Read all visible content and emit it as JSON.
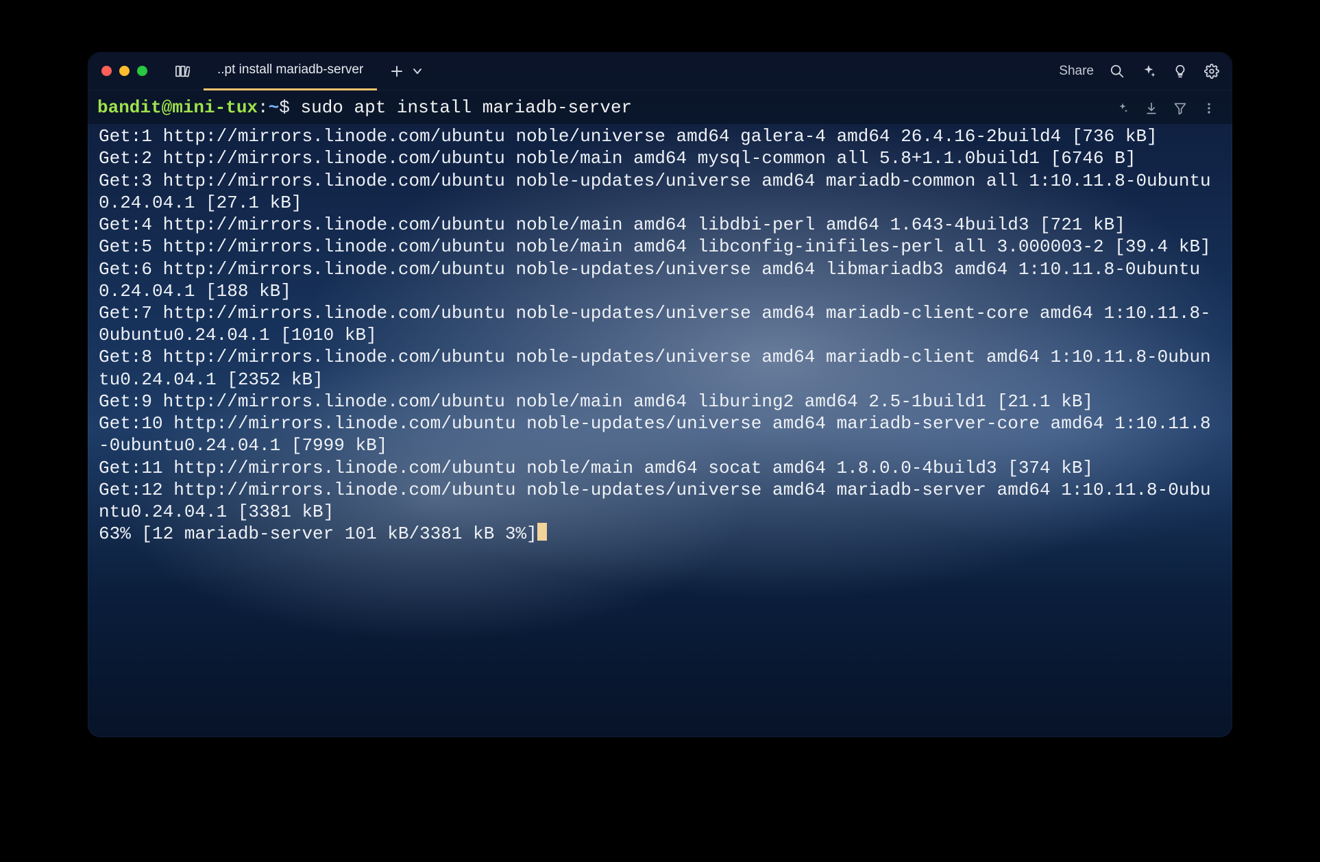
{
  "window": {
    "traffic_lights": {
      "close": "close",
      "minimize": "minimize",
      "zoom": "zoom"
    },
    "library_icon": "library-icon",
    "tab_title": "..pt install mariadb-server",
    "new_tab_icon": "plus-icon",
    "dropdown_icon": "chevron-down-icon",
    "share_label": "Share",
    "search_icon": "search-icon",
    "sparkle_icon": "sparkle-icon",
    "bulb_icon": "lightbulb-icon",
    "settings_icon": "gear-icon"
  },
  "prompt": {
    "user_host": "bandit@mini-tux",
    "colon": ":",
    "path": "~",
    "dollar": "$ ",
    "command": "sudo apt install mariadb-server",
    "ai_icon": "sparkle-small-icon",
    "download_icon": "download-icon",
    "filter_icon": "filter-icon",
    "more_icon": "more-vertical-icon"
  },
  "output": {
    "lines": [
      "Get:1 http://mirrors.linode.com/ubuntu noble/universe amd64 galera-4 amd64 26.4.16-2build4 [736 kB]",
      "Get:2 http://mirrors.linode.com/ubuntu noble/main amd64 mysql-common all 5.8+1.1.0build1 [6746 B]",
      "Get:3 http://mirrors.linode.com/ubuntu noble-updates/universe amd64 mariadb-common all 1:10.11.8-0ubuntu0.24.04.1 [27.1 kB]",
      "Get:4 http://mirrors.linode.com/ubuntu noble/main amd64 libdbi-perl amd64 1.643-4build3 [721 kB]",
      "Get:5 http://mirrors.linode.com/ubuntu noble/main amd64 libconfig-inifiles-perl all 3.000003-2 [39.4 kB]",
      "Get:6 http://mirrors.linode.com/ubuntu noble-updates/universe amd64 libmariadb3 amd64 1:10.11.8-0ubuntu0.24.04.1 [188 kB]",
      "Get:7 http://mirrors.linode.com/ubuntu noble-updates/universe amd64 mariadb-client-core amd64 1:10.11.8-0ubuntu0.24.04.1 [1010 kB]",
      "Get:8 http://mirrors.linode.com/ubuntu noble-updates/universe amd64 mariadb-client amd64 1:10.11.8-0ubuntu0.24.04.1 [2352 kB]",
      "Get:9 http://mirrors.linode.com/ubuntu noble/main amd64 liburing2 amd64 2.5-1build1 [21.1 kB]",
      "Get:10 http://mirrors.linode.com/ubuntu noble-updates/universe amd64 mariadb-server-core amd64 1:10.11.8-0ubuntu0.24.04.1 [7999 kB]",
      "Get:11 http://mirrors.linode.com/ubuntu noble/main amd64 socat amd64 1.8.0.0-4build3 [374 kB]",
      "Get:12 http://mirrors.linode.com/ubuntu noble-updates/universe amd64 mariadb-server amd64 1:10.11.8-0ubuntu0.24.04.1 [3381 kB]"
    ],
    "progress": "63% [12 mariadb-server 101 kB/3381 kB 3%]"
  }
}
